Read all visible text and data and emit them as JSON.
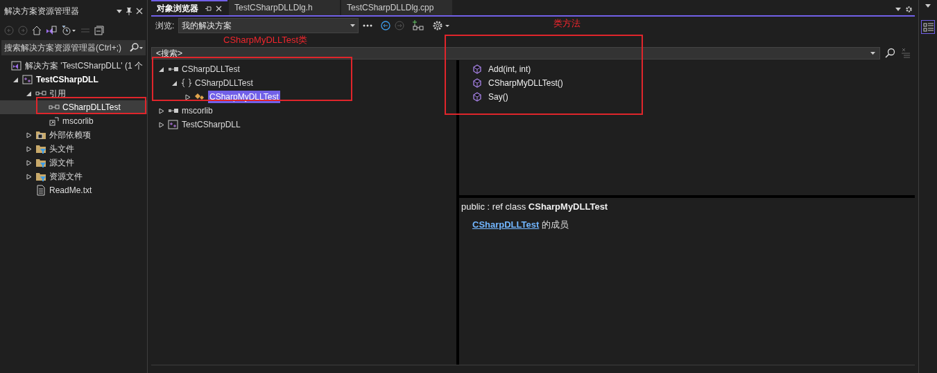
{
  "solution_explorer": {
    "title": "解决方案资源管理器",
    "search": {
      "placeholder": "搜索解决方案资源管理器(Ctrl+;)"
    },
    "tree": [
      {
        "kind": "solution",
        "label": "解决方案 'TestCSharpDLL' (1 个",
        "selected": false
      },
      {
        "kind": "project",
        "label": "TestCSharpDLL",
        "selected": false,
        "expanded": true,
        "children": [
          {
            "kind": "reference",
            "label": "引用",
            "selected": false,
            "expanded": true,
            "children": [
              {
                "kind": "reference",
                "label": "CSharpDLLTest",
                "selected": true
              },
              {
                "kind": "assembly-ref",
                "label": "mscorlib",
                "selected": false
              }
            ]
          },
          {
            "kind": "ext-folder",
            "label": "外部依赖项",
            "selected": false,
            "expanded": false
          },
          {
            "kind": "filter-folder",
            "label": "头文件",
            "selected": false,
            "expanded": false
          },
          {
            "kind": "filter-folder",
            "label": "源文件",
            "selected": false,
            "expanded": false
          },
          {
            "kind": "filter-folder",
            "label": "资源文件",
            "selected": false,
            "expanded": false
          },
          {
            "kind": "file",
            "label": "ReadMe.txt",
            "selected": false
          }
        ]
      }
    ]
  },
  "tabs": [
    {
      "label": "对象浏览器",
      "selected": true
    },
    {
      "label": "TestCSharpDLLDlg.h",
      "selected": false
    },
    {
      "label": "TestCSharpDLLDlg.cpp",
      "selected": false
    }
  ],
  "object_browser": {
    "browse_label": "浏览:",
    "browse_value": "我的解决方案",
    "search": {
      "placeholder": "<搜索>"
    },
    "tree": [
      {
        "kind": "assembly",
        "label": "CSharpDLLTest",
        "selected": false,
        "expanded": true,
        "children": [
          {
            "kind": "namespace",
            "label": "CSharpDLLTest",
            "selected": false,
            "expanded": true,
            "children": [
              {
                "kind": "class",
                "label": "CSharpMyDLLTest",
                "selected": true,
                "expanded": false
              }
            ]
          }
        ]
      },
      {
        "kind": "assembly",
        "label": "mscorlib",
        "selected": false,
        "expanded": false
      },
      {
        "kind": "project",
        "label": "TestCSharpDLL",
        "selected": false,
        "expanded": false
      }
    ],
    "members": [
      "Add(int, int)",
      "CSharpMyDLLTest()",
      "Say()"
    ],
    "description": {
      "signature": "public : ref class **CSharpMyDLLTest**",
      "member_of_link": "CSharpDLLTest",
      "member_of_suffix": " 的成员"
    }
  },
  "annotations": [
    {
      "kind": "box"
    },
    {
      "kind": "box"
    },
    {
      "kind": "box"
    },
    {
      "kind": "label",
      "text": "CSharpMyDLLTest类"
    },
    {
      "kind": "label",
      "text": "类方法"
    }
  ]
}
